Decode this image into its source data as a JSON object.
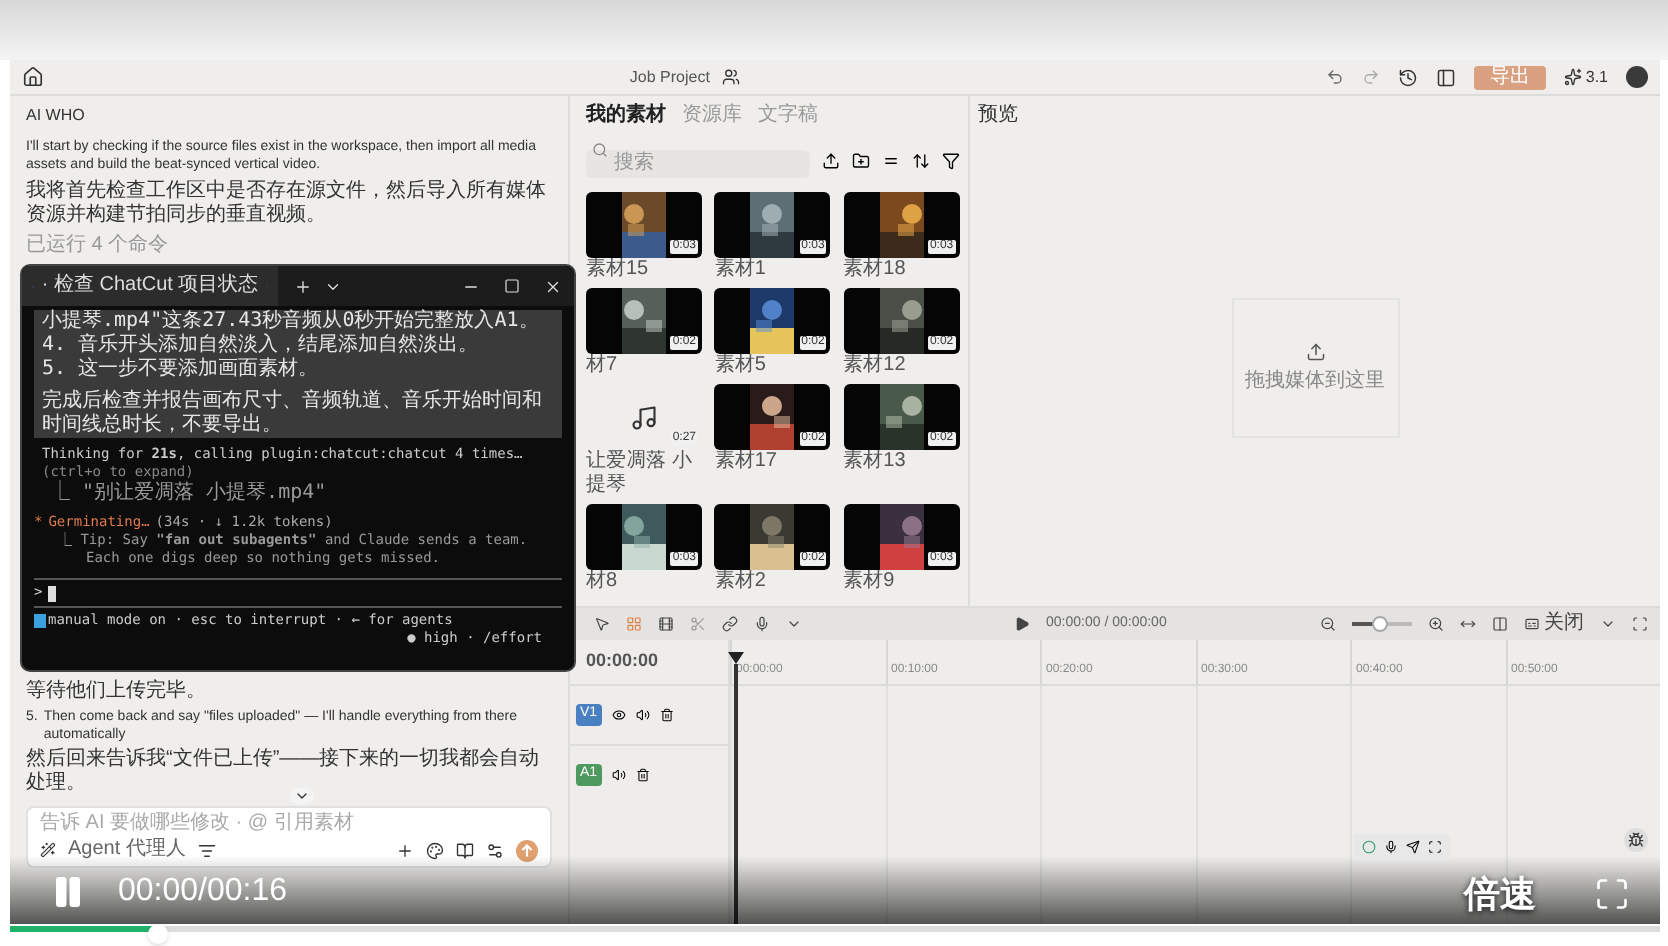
{
  "app_bar": {
    "project": "Job Project",
    "export_button": "导出",
    "credits": "3.1"
  },
  "chat": {
    "agent_name": "AI WHO",
    "intro": "I'll start by checking if the source files exist in the workspace, then import all media assets and build the beat-synced vertical video.",
    "intro_zh": "我将首先检查工作区中是否存在源文件，然后导入所有媒体资源并构建节拍同步的垂直视频。",
    "ran_commands": "已运行 4 个命令",
    "waiting": "等待他们上传完毕。",
    "step": {
      "number": "5.",
      "text": "Then come back and say \"files uploaded\" — I'll handle everything from there automatically",
      "text_zh": "然后回来告诉我“文件已上传”——接下来的一切我都会自动处理。"
    },
    "input": {
      "placeholder": "告诉 AI 要做哪些修改 · @ 引用素材"
    },
    "mode_label": "Agent 代理人"
  },
  "terminal": {
    "tab_title": "· 检查 ChatCut 项目状态",
    "prompt_paragraphs": [
      [
        "小提琴.mp4\"这条27.43秒音频从0秒开始完整放入A1。",
        "4. 音乐开头添加自然淡入，结尾添加自然淡出。",
        "5. 这一步不要添加画面素材。"
      ],
      [
        "完成后检查并报告画布尺寸、音频轨道、音乐开始时间和时间线总时长，不要导出。"
      ]
    ],
    "thinking": "Thinking for **21s**, calling plugin:chatcut:chatcut 4 times…",
    "expand_hint": "(ctrl+o to expand)",
    "tool_call": "⎿ \"别让爱凋落 小提琴.mp4\"",
    "status_mark": "*",
    "status": "Germinating…",
    "status_detail": "(34s · ↓ 1.2k tokens)",
    "tip": [
      "⎿ Tip: Say **\"fan out subagents\"** and Claude sends a team.",
      "Each one digs deep so nothing gets missed."
    ],
    "prompt_symbol": ">",
    "footer": "manual mode on · esc to interrupt · ← for agents",
    "effort": "● high · /effort"
  },
  "media": {
    "tabs": [
      {
        "label": "我的素材",
        "selected": true
      },
      {
        "label": "资源库",
        "selected": false
      },
      {
        "label": "文字稿",
        "selected": false
      }
    ],
    "search": {
      "placeholder": "搜索"
    },
    "items": [
      {
        "kind": "video",
        "name": "素材15",
        "duration": "0:03"
      },
      {
        "kind": "video",
        "name": "素材1",
        "duration": "0:03"
      },
      {
        "kind": "video",
        "name": "素材18",
        "duration": "0:03"
      },
      {
        "kind": "video",
        "name": "材7",
        "duration": "0:02"
      },
      {
        "kind": "video",
        "name": "素材5",
        "duration": "0:02"
      },
      {
        "kind": "video",
        "name": "素材12",
        "duration": "0:02"
      },
      {
        "kind": "audio",
        "name": "让爱凋落 小提琴",
        "duration": "0:27"
      },
      {
        "kind": "video",
        "name": "素材17",
        "duration": "0:02"
      },
      {
        "kind": "video",
        "name": "素材13",
        "duration": "0:02"
      },
      {
        "kind": "video",
        "name": "材8",
        "duration": "0:03"
      },
      {
        "kind": "video",
        "name": "素材2",
        "duration": "0:02"
      },
      {
        "kind": "video",
        "name": "素材9",
        "duration": "0:03"
      }
    ]
  },
  "preview": {
    "title": "预览",
    "drop_hint": "拖拽媒体到这里"
  },
  "timeline": {
    "time": "00:00:00 / 00:00:00",
    "zoom": {
      "level": 0.45
    },
    "toggle_label": "关闭",
    "current": "00:00:00",
    "ticks": [
      "00:00:00",
      "00:10:00",
      "00:20:00",
      "00:30:00",
      "00:40:00",
      "00:50:00"
    ],
    "tracks": [
      {
        "kind": "video",
        "label": "V1",
        "color": "#4a7fc1"
      },
      {
        "kind": "audio",
        "label": "A1",
        "color": "#4e9a5e"
      }
    ]
  },
  "player": {
    "playing": true,
    "time": "00:00/00:16",
    "speed": "倍速",
    "progress": {
      "level": 0.09
    }
  }
}
